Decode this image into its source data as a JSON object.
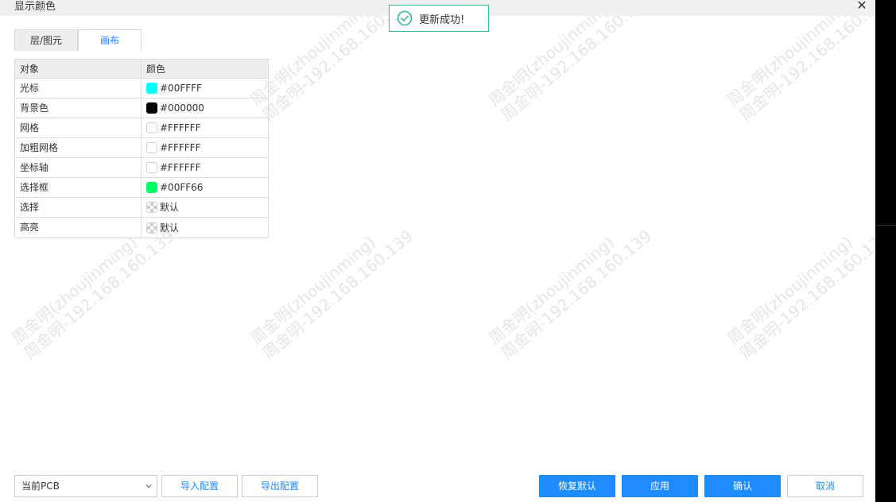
{
  "window": {
    "title": "显示颜色",
    "close_glyph": "✕"
  },
  "tabs": [
    {
      "label": "层/图元",
      "active": false
    },
    {
      "label": "画布",
      "active": true
    }
  ],
  "table": {
    "headers": {
      "object": "对象",
      "color": "颜色"
    },
    "rows": [
      {
        "object": "光标",
        "value": "#00FFFF",
        "swatch": "#00FFFF"
      },
      {
        "object": "背景色",
        "value": "#000000",
        "swatch": "#000000"
      },
      {
        "object": "网格",
        "value": "#FFFFFF",
        "swatch": "#FFFFFF"
      },
      {
        "object": "加粗网格",
        "value": "#FFFFFF",
        "swatch": "#FFFFFF"
      },
      {
        "object": "坐标轴",
        "value": "#FFFFFF",
        "swatch": "#FFFFFF"
      },
      {
        "object": "选择框",
        "value": "#00FF66",
        "swatch": "#00FF66"
      },
      {
        "object": "选择",
        "value": "默认",
        "swatch": "checker"
      },
      {
        "object": "高亮",
        "value": "默认",
        "swatch": "checker"
      }
    ]
  },
  "toast": {
    "message": "更新成功!",
    "icon": "check-circle-icon",
    "color": "#35b89a"
  },
  "watermark": {
    "line1": "周金明(zhoujinming)",
    "line2": "周金明-192.168.160.139"
  },
  "footer": {
    "scope_select": "当前PCB",
    "import_label": "导入配置",
    "export_label": "导出配置",
    "restore_label": "恢复默认",
    "apply_label": "应用",
    "confirm_label": "确认",
    "cancel_label": "取消"
  },
  "colors": {
    "accent": "#1e8cff",
    "success": "#35b89a"
  }
}
